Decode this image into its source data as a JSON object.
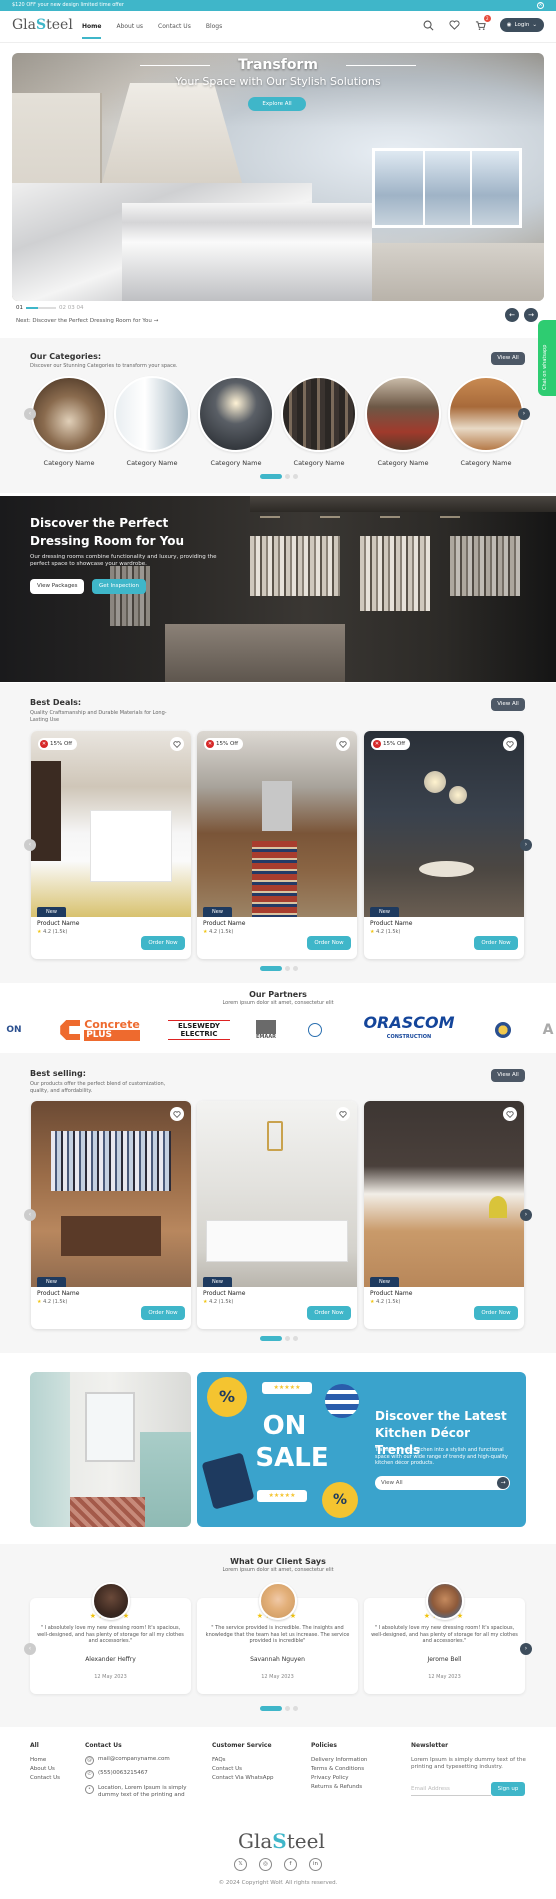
{
  "promo": {
    "text": "$120 OFF your new design limited time offer"
  },
  "nav": {
    "logo_prefix": "Gla",
    "logo_s": "S",
    "logo_suffix": "teel",
    "links": [
      "Home",
      "About us",
      "Contact Us",
      "Blogs"
    ],
    "active": "Home",
    "cart_count": "2",
    "login": "Login"
  },
  "hero": {
    "title": "Transform",
    "subtitle": "Your Space with Our Stylish Solutions",
    "cta": "Explore All",
    "slide_current": "01",
    "slides_other": "02  03  04",
    "next_label": "Next: Discover the Perfect Dressing Room for You"
  },
  "categories": {
    "title": "Our Categories:",
    "desc": "Discover our Stunning Categories to transform your space.",
    "view_all": "View All",
    "items": [
      "Category Name",
      "Category Name",
      "Category Name",
      "Category Name",
      "Category Name",
      "Category Name"
    ]
  },
  "chat": {
    "label": "Chat on whatsapp"
  },
  "dressing": {
    "title": "Discover the Perfect Dressing Room for You",
    "text": "Our dressing rooms combine functionality and luxury, providing the perfect space to showcase your wardrobe.",
    "btn_packages": "View Packages",
    "btn_inspection": "Get Inspection"
  },
  "best_deals": {
    "title": "Best Deals:",
    "desc": "Quality Craftsmanship and Durable Materials for Long-Lasting Use",
    "view_all": "View All",
    "products": [
      {
        "discount": "15% Off",
        "badge": "New",
        "name": "Product Name",
        "rating": "4.2 (1.5k)",
        "order": "Order Now"
      },
      {
        "discount": "15% Off",
        "badge": "New",
        "name": "Product Name",
        "rating": "4.2 (1.5k)",
        "order": "Order Now"
      },
      {
        "discount": "15% Off",
        "badge": "New",
        "name": "Product Name",
        "rating": "4.2 (1.5k)",
        "order": "Order Now"
      }
    ]
  },
  "partners": {
    "title": "Our Partners",
    "desc": "Lorem ipsum dolor sit amet, consectetur elit",
    "logos": [
      "Concrete PLUS",
      "ELSEWEDY ELECTRIC",
      "EMAAR",
      "ORASCOM CONSTRUCTION"
    ]
  },
  "best_selling": {
    "title": "Best selling:",
    "desc": "Our products offer the perfect blend of customization, quality, and affordability.",
    "view_all": "View All",
    "products": [
      {
        "badge": "New",
        "name": "Product Name",
        "rating": "4.2 (1.5k)",
        "order": "Order Now"
      },
      {
        "badge": "New",
        "name": "Product Name",
        "rating": "4.2 (1.5k)",
        "order": "Order Now"
      },
      {
        "badge": "New",
        "name": "Product Name",
        "rating": "4.2 (1.5k)",
        "order": "Order Now"
      }
    ]
  },
  "sale_banner": {
    "on": "ON",
    "sale": "SALE",
    "title": "Discover the Latest Kitchen Décor Trends",
    "text": "Transform your kitchen into a stylish and functional space with our wide range of trendy and high-quality kitchen décor products.",
    "view_all": "View All"
  },
  "testimonials": {
    "title": "What Our Client Says",
    "desc": "Lorem ipsum dolor sit amet, consectetur elit",
    "items": [
      {
        "stars": "★★★★★",
        "text": "\" I absolutely love my new dressing room! It's spacious, well-designed, and has plenty of storage for all my clothes and accessories.\"",
        "name": "Alexander Heffry",
        "date": "12 May 2023"
      },
      {
        "stars": "★★★★★",
        "text": "\" The service provided is incredible. The insights and knowledge that the team has let us increase. The service provided is incredible\"",
        "name": "Savannah Nguyen",
        "date": "12 May 2023"
      },
      {
        "stars": "★★★★★",
        "text": "\" I absolutely love my new dressing room! It's spacious, well-designed, and has plenty of storage for all my clothes and accessories.\"",
        "name": "Jerome Bell",
        "date": "12 May 2023"
      }
    ]
  },
  "footer": {
    "all_title": "All",
    "all_links": [
      "Home",
      "About Us",
      "Contact Us"
    ],
    "contact_title": "Contact Us",
    "email": "mail@companyname.com",
    "phone": "(555)0063215467",
    "location": "Location, Lorem Ipsum is simply dummy text of the printing and",
    "service_title": "Customer Service",
    "service_links": [
      "FAQs",
      "Contact Us",
      "Contact Via WhatsApp"
    ],
    "policies_title": "Policies",
    "policies_links": [
      "Delivery Information",
      "Terms & Conditions",
      "Privacy Policy",
      "Returns & Refunds"
    ],
    "newsletter_title": "Newsletter",
    "newsletter_text": "Lorem Ipsum is simply dummy text of the printing and typesetting industry.",
    "email_placeholder": "Email Address",
    "signup": "Sign up",
    "copyright": "© 2024 Copyright Wolf. All rights reserved."
  }
}
